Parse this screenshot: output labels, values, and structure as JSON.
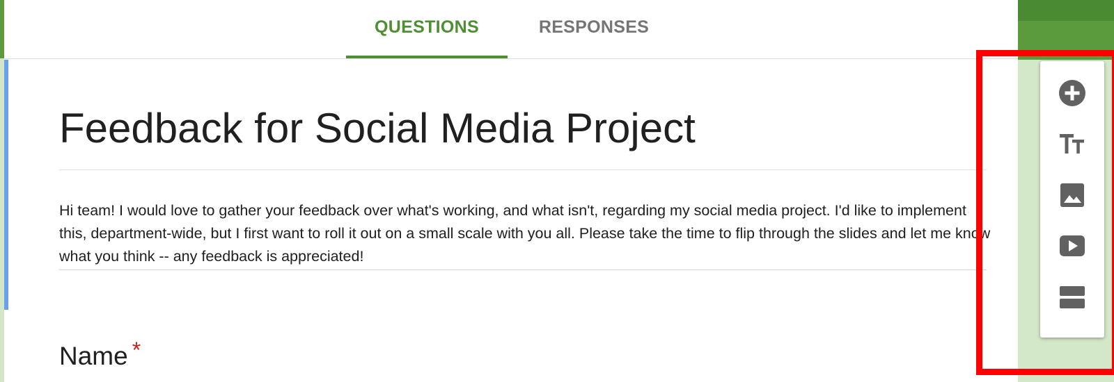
{
  "tabs": [
    {
      "label": "QUESTIONS",
      "active": true
    },
    {
      "label": "RESPONSES",
      "active": false
    }
  ],
  "form": {
    "title": "Feedback for Social Media Project",
    "description": "Hi team! I would love to gather your feedback over what's working, and what isn't, regarding my social media project. I'd like to implement this, department-wide, but I first want to roll it out on a small scale with you all. Please take the time to flip through the slides and let me know what you think -- any feedback is appreciated!"
  },
  "question": {
    "title": "Name",
    "required_mark": "*"
  },
  "toolbar": {
    "icons": [
      "add-question-icon",
      "title-text-icon",
      "image-icon",
      "video-icon",
      "section-icon"
    ]
  },
  "colors": {
    "accent": "#4f8f34",
    "tab_inactive": "#757575",
    "theme_bg": "#d3e7c9",
    "required": "#c5221f",
    "highlight": "#ff0000",
    "icon": "#616161"
  }
}
